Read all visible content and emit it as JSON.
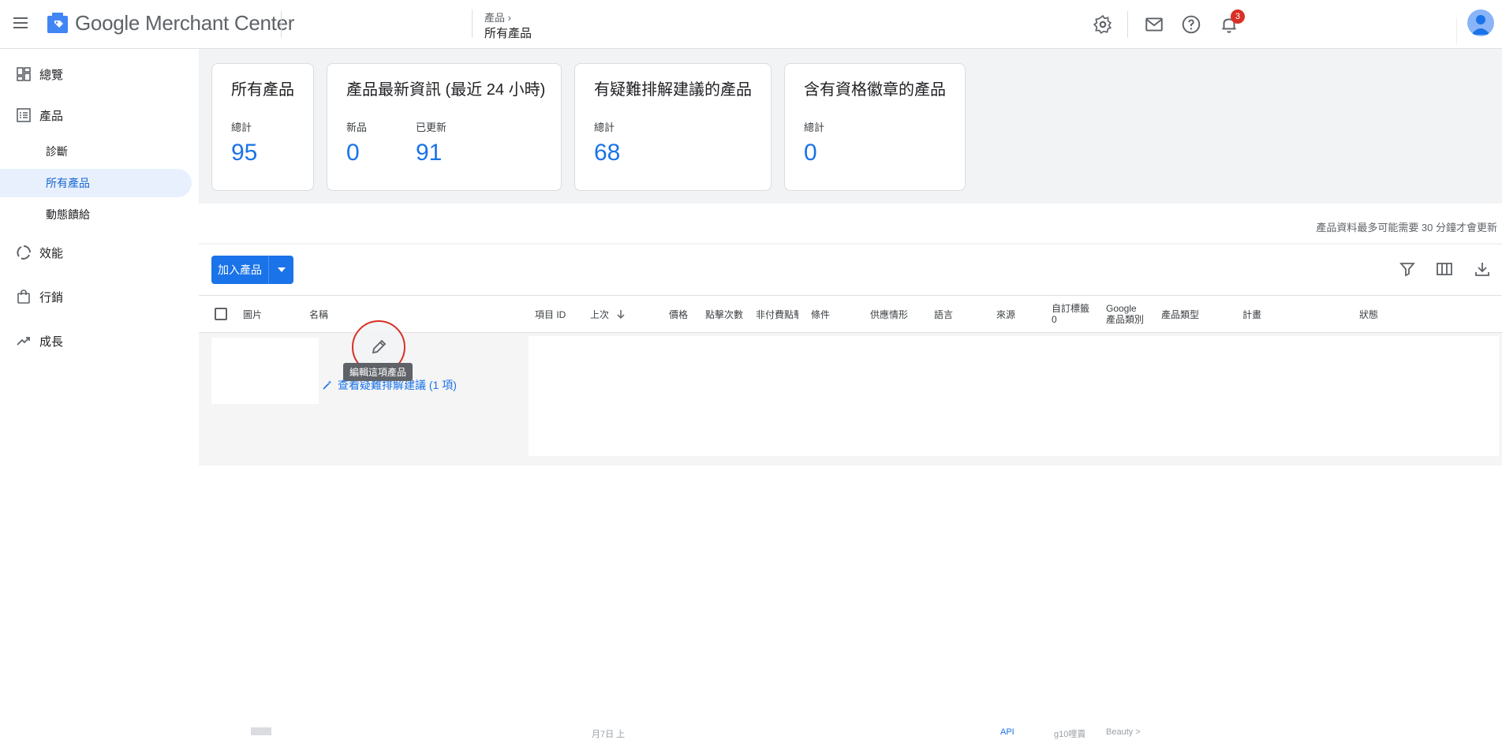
{
  "topbar": {
    "brand": "Google Merchant Center",
    "breadcrumb_parent": "產品",
    "page_title": "所有產品",
    "notification_count": "3"
  },
  "sidebar": {
    "items": [
      {
        "label": "總覽"
      },
      {
        "label": "產品"
      },
      {
        "label": "診斷"
      },
      {
        "label": "所有產品"
      },
      {
        "label": "動態饋給"
      },
      {
        "label": "效能"
      },
      {
        "label": "行銷"
      },
      {
        "label": "成長"
      }
    ]
  },
  "cards": {
    "all": {
      "title": "所有產品",
      "label": "總計",
      "value": "95"
    },
    "updates": {
      "title": "產品最新資訊 (最近 24 小時)",
      "new_label": "新品",
      "new_value": "0",
      "updated_label": "已更新",
      "updated_value": "91"
    },
    "troubleshoot": {
      "title": "有疑難排解建議的產品",
      "label": "總計",
      "value": "68"
    },
    "badge": {
      "title": "含有資格徽章的產品",
      "label": "總計",
      "value": "0"
    }
  },
  "notice": "產品資料最多可能需要 30 分鐘才會更新",
  "toolbar": {
    "add_label": "加入產品"
  },
  "table": {
    "headers": {
      "image": "圖片",
      "name": "名稱",
      "item_id": "項目 ID",
      "last_updated": "上次",
      "price": "價格",
      "clicks": "點擊次數",
      "unpaid_clicks": "非付費點擊",
      "condition": "條件",
      "availability": "供應情形",
      "language": "語言",
      "source": "來源",
      "custom_label_line1": "自訂標籤",
      "custom_label_line2": "0",
      "google_category_line1": "Google",
      "google_category_line2": "產品類別",
      "product_type": "產品類型",
      "program": "計畫",
      "status": "狀態"
    },
    "row": {
      "link": "查看疑難排解建議 (1 項)",
      "tooltip": "編輯這項產品"
    },
    "partial_row": {
      "date": "月7日 上",
      "source": "API",
      "custom": "g10哩賣",
      "category": "Beauty >"
    }
  },
  "colors": {
    "accent": "#1a73e8",
    "badge": "#d93025",
    "highlight_circle": "#d93025"
  }
}
